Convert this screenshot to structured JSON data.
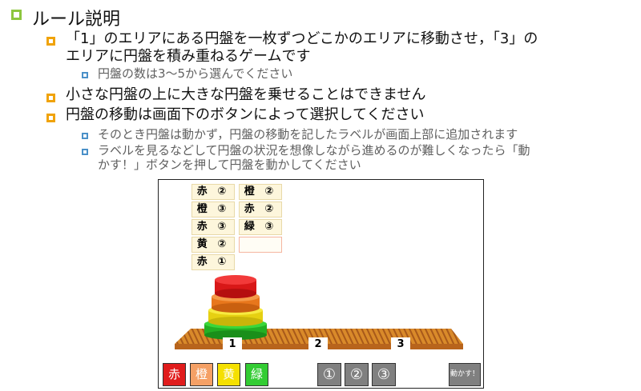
{
  "rules": {
    "title": "ルール説明",
    "item1_line1": "「1」のエリアにある円盤を一枚ずつどこかのエリアに移動させ，「3」の",
    "item1_line2": "エリアに円盤を積み重ねるゲームです",
    "item1_sub": "円盤の数は3～5から選んでください",
    "item2": "小さな円盤の上に大きな円盤を乗せることはできません",
    "item3": "円盤の移動は画面下のボタンによって選択してください",
    "item3_sub1": "そのとき円盤は動かず，円盤の移動を記したラベルが画面上部に追加されます",
    "item3_sub2_line1": "ラベルを見るなどして円盤の状況を想像しながら進めるのが難しくなったら「動",
    "item3_sub2_line2": "かす！」ボタンを押して円盤を動かしてください"
  },
  "game": {
    "labels_col1": [
      "赤 ②",
      "橙 ③",
      "赤 ③",
      "黄 ②",
      "赤 ①"
    ],
    "labels_col2": [
      "橙 ②",
      "赤 ②",
      "緑 ③",
      ""
    ],
    "areas": [
      "1",
      "2",
      "3"
    ],
    "disks": [
      {
        "name": "red",
        "color": "#e81c1c"
      },
      {
        "name": "orange",
        "color": "#f08a30"
      },
      {
        "name": "yellow",
        "color": "#f2e21a"
      },
      {
        "name": "green",
        "color": "#2ec82e"
      }
    ],
    "color_buttons": [
      {
        "label": "赤",
        "color": "#e01c1c"
      },
      {
        "label": "橙",
        "color": "#f5a065"
      },
      {
        "label": "黄",
        "color": "#f5e000"
      },
      {
        "label": "緑",
        "color": "#33cc33"
      }
    ],
    "number_buttons": [
      "①",
      "②",
      "③"
    ],
    "move_button": "動かす！"
  }
}
